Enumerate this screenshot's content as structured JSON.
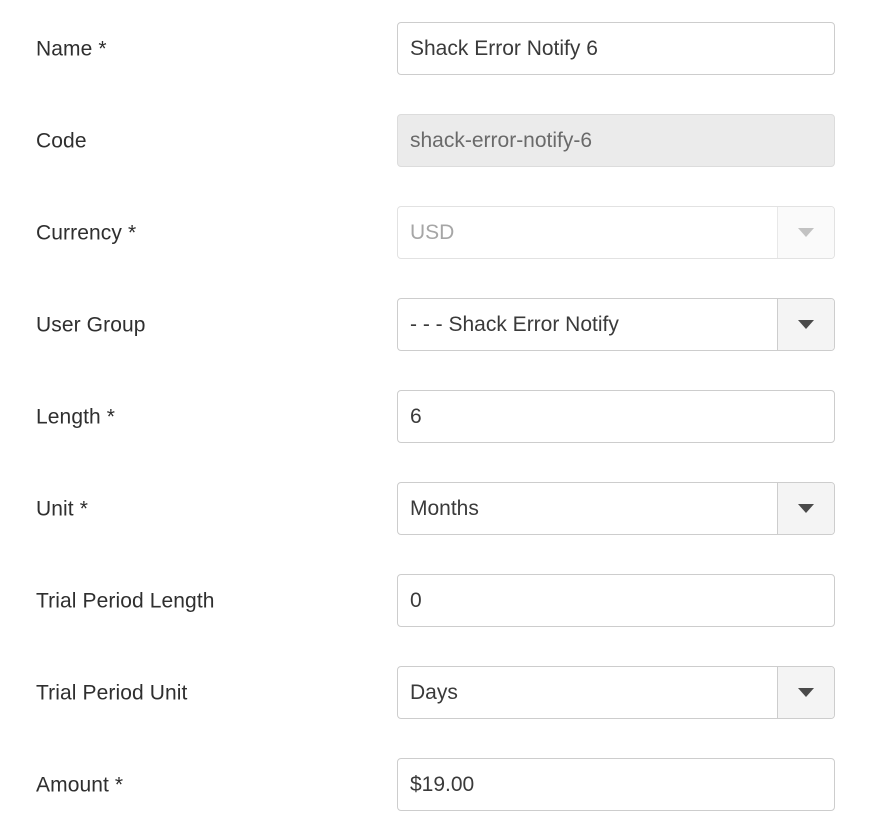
{
  "form": {
    "rows": [
      {
        "label": "Name",
        "required": true,
        "type": "text",
        "value": "Shack Error Notify 6",
        "state": "enabled"
      },
      {
        "label": "Code",
        "required": false,
        "type": "text",
        "value": "shack-error-notify-6",
        "state": "readonly"
      },
      {
        "label": "Currency",
        "required": true,
        "type": "select",
        "value": "USD",
        "state": "disabled",
        "icon": "chevron-down-icon"
      },
      {
        "label": "User Group",
        "required": false,
        "type": "select",
        "value": "- - - Shack Error Notify",
        "state": "enabled",
        "icon": "chevron-down-icon"
      },
      {
        "label": "Length",
        "required": true,
        "type": "text",
        "value": "6",
        "state": "enabled"
      },
      {
        "label": "Unit",
        "required": true,
        "type": "select",
        "value": "Months",
        "state": "enabled",
        "icon": "chevron-down-icon"
      },
      {
        "label": "Trial Period Length",
        "required": false,
        "type": "text",
        "value": "0",
        "state": "enabled"
      },
      {
        "label": "Trial Period Unit",
        "required": false,
        "type": "select",
        "value": "Days",
        "state": "enabled",
        "icon": "chevron-down-icon"
      },
      {
        "label": "Amount",
        "required": true,
        "type": "text",
        "value": "$19.00",
        "state": "enabled"
      }
    ],
    "required_marker": "*",
    "colors": {
      "label_text": "#2f2f2f",
      "value_text": "#3a3a3a",
      "border": "#cdcdcd",
      "readonly_fill": "#ebebeb",
      "arrow_fill": "#f4f4f4",
      "disabled_text": "#a6a6a6"
    }
  }
}
